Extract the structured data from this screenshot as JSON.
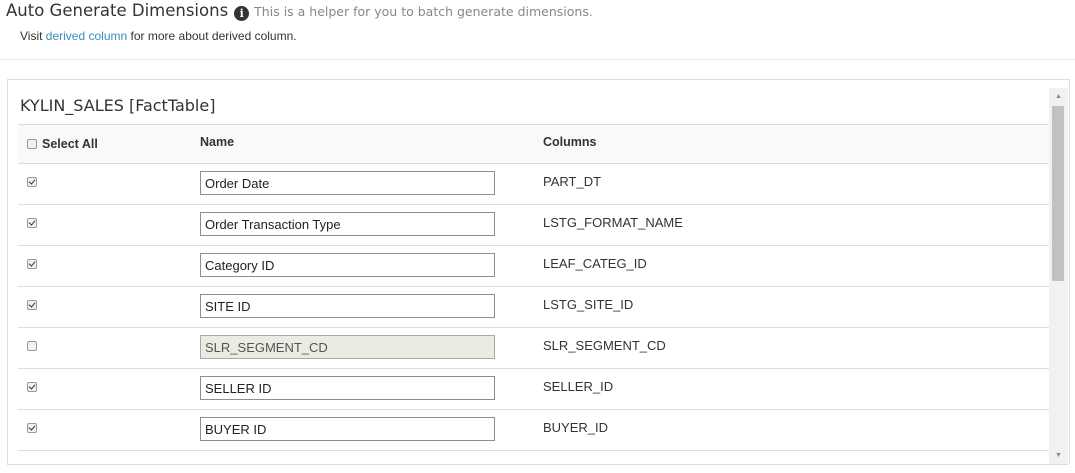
{
  "header": {
    "title": "Auto Generate Dimensions",
    "info_icon_glyph": "i",
    "helper_text": "This is a helper for you to batch generate dimensions.",
    "visit_prefix": "Visit",
    "visit_link": "derived column",
    "visit_suffix": "for more about derived column."
  },
  "panel": {
    "table_title": "KYLIN_SALES [FactTable]",
    "columns": {
      "select_all": "Select All",
      "name": "Name",
      "columns": "Columns"
    },
    "select_all_checked": false,
    "rows": [
      {
        "checked": true,
        "name": "Order Date",
        "column": "PART_DT",
        "disabled": false
      },
      {
        "checked": true,
        "name": "Order Transaction Type",
        "column": "LSTG_FORMAT_NAME",
        "disabled": false
      },
      {
        "checked": true,
        "name": "Category ID",
        "column": "LEAF_CATEG_ID",
        "disabled": false
      },
      {
        "checked": true,
        "name": "SITE ID",
        "column": "LSTG_SITE_ID",
        "disabled": false
      },
      {
        "checked": false,
        "name": "SLR_SEGMENT_CD",
        "column": "SLR_SEGMENT_CD",
        "disabled": true
      },
      {
        "checked": true,
        "name": "SELLER ID",
        "column": "SELLER_ID",
        "disabled": false
      },
      {
        "checked": true,
        "name": "BUYER ID",
        "column": "BUYER_ID",
        "disabled": false
      }
    ]
  },
  "colors": {
    "link": "#3c8dbc",
    "header_row_bg": "#f9f9f9",
    "border": "#dddddd",
    "disabled_input_bg": "#ebebe4"
  },
  "icons": {
    "info": "info-circle-icon",
    "scroll_up": "scroll-up-arrow-icon",
    "scroll_down": "scroll-down-arrow-icon"
  }
}
